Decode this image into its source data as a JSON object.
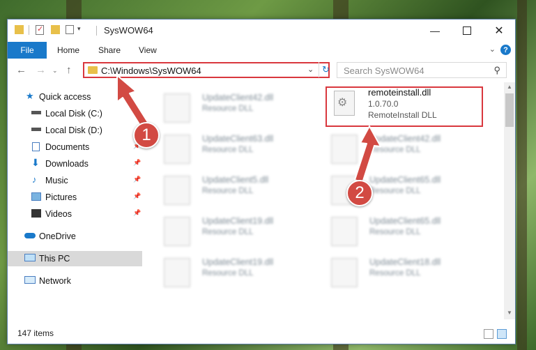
{
  "window": {
    "title": "SysWOW64",
    "minimize_icon": "minimize-icon",
    "maximize_icon": "maximize-icon",
    "close_icon": "close-icon"
  },
  "ribbon": {
    "tabs": [
      "File",
      "Home",
      "Share",
      "View"
    ],
    "help_label": "?"
  },
  "navigation": {
    "address": "C:\\Windows\\SysWOW64",
    "search_placeholder": "Search SysWOW64"
  },
  "sidebar": {
    "items": [
      {
        "label": "Quick access",
        "icon": "star-icon",
        "pinned": false
      },
      {
        "label": "Local Disk (C:)",
        "icon": "drive-icon",
        "pinned": true
      },
      {
        "label": "Local Disk (D:)",
        "icon": "drive-icon",
        "pinned": false
      },
      {
        "label": "Documents",
        "icon": "documents-icon",
        "pinned": true
      },
      {
        "label": "Downloads",
        "icon": "downloads-icon",
        "pinned": true
      },
      {
        "label": "Music",
        "icon": "music-icon",
        "pinned": true
      },
      {
        "label": "Pictures",
        "icon": "pictures-icon",
        "pinned": true
      },
      {
        "label": "Videos",
        "icon": "videos-icon",
        "pinned": true
      },
      {
        "label": "OneDrive",
        "icon": "cloud-icon",
        "pinned": false
      },
      {
        "label": "This PC",
        "icon": "computer-icon",
        "pinned": false,
        "selected": true
      },
      {
        "label": "Network",
        "icon": "network-icon",
        "pinned": false
      }
    ]
  },
  "files": {
    "left_column": [
      {
        "name": "UpdateClient42.dll",
        "desc": "Resource DLL"
      },
      {
        "name": "UpdateClient63.dll",
        "desc": "Resource DLL"
      },
      {
        "name": "UpdateClient5.dll",
        "desc": "Resource DLL"
      },
      {
        "name": "UpdateClient19.dll",
        "desc": "Resource DLL"
      },
      {
        "name": "UpdateClient19.dll",
        "desc": "Resource DLL"
      }
    ],
    "highlighted": {
      "name": "remoteinstall.dll",
      "version": "1.0.70.0",
      "desc": "RemoteInstall DLL"
    },
    "right_column": [
      {
        "name": "UpdateClient42.dll",
        "desc": "Resource DLL"
      },
      {
        "name": "UpdateClient65.dll",
        "desc": "Resource DLL"
      },
      {
        "name": "UpdateClient65.dll",
        "desc": "Resource DLL"
      },
      {
        "name": "UpdateClient18.dll",
        "desc": "Resource DLL"
      }
    ]
  },
  "status": {
    "item_count": "147 items"
  },
  "callouts": {
    "one": "1",
    "two": "2"
  },
  "colors": {
    "accent": "#1979ca",
    "highlight_red": "#d9373d",
    "callout_red": "#d24a43"
  }
}
